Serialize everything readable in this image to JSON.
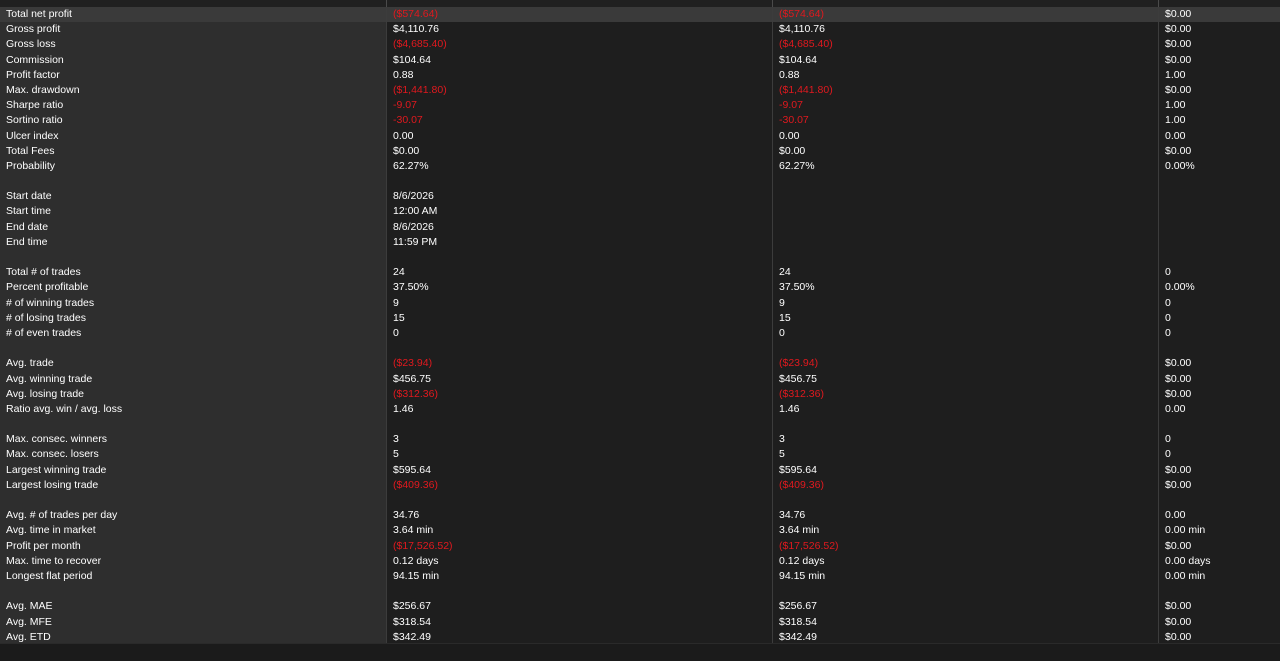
{
  "rows": [
    {
      "label": "Total net profit",
      "c1": "($574.64)",
      "c2": "($574.64)",
      "c3": "$0.00",
      "neg1": true,
      "neg2": true
    },
    {
      "label": "Gross profit",
      "c1": "$4,110.76",
      "c2": "$4,110.76",
      "c3": "$0.00"
    },
    {
      "label": "Gross loss",
      "c1": "($4,685.40)",
      "c2": "($4,685.40)",
      "c3": "$0.00",
      "neg1": true,
      "neg2": true
    },
    {
      "label": "Commission",
      "c1": "$104.64",
      "c2": "$104.64",
      "c3": "$0.00"
    },
    {
      "label": "Profit factor",
      "c1": "0.88",
      "c2": "0.88",
      "c3": "1.00"
    },
    {
      "label": "Max. drawdown",
      "c1": "($1,441.80)",
      "c2": "($1,441.80)",
      "c3": "$0.00",
      "neg1": true,
      "neg2": true
    },
    {
      "label": "Sharpe ratio",
      "c1": "-9.07",
      "c2": "-9.07",
      "c3": "1.00",
      "neg1": true,
      "neg2": true
    },
    {
      "label": "Sortino ratio",
      "c1": "-30.07",
      "c2": "-30.07",
      "c3": "1.00",
      "neg1": true,
      "neg2": true
    },
    {
      "label": "Ulcer index",
      "c1": "0.00",
      "c2": "0.00",
      "c3": "0.00"
    },
    {
      "label": "Total Fees",
      "c1": "$0.00",
      "c2": "$0.00",
      "c3": "$0.00"
    },
    {
      "label": "Probability",
      "c1": "62.27%",
      "c2": "62.27%",
      "c3": "0.00%"
    },
    {
      "gap": true
    },
    {
      "label": "Start date",
      "c1": "8/6/2026",
      "c2": "",
      "c3": ""
    },
    {
      "label": "Start time",
      "c1": "12:00 AM",
      "c2": "",
      "c3": ""
    },
    {
      "label": "End date",
      "c1": "8/6/2026",
      "c2": "",
      "c3": ""
    },
    {
      "label": "End time",
      "c1": "11:59 PM",
      "c2": "",
      "c3": ""
    },
    {
      "gap": true
    },
    {
      "label": "Total # of trades",
      "c1": "24",
      "c2": "24",
      "c3": "0"
    },
    {
      "label": "Percent profitable",
      "c1": "37.50%",
      "c2": "37.50%",
      "c3": "0.00%"
    },
    {
      "label": "# of winning trades",
      "c1": "9",
      "c2": "9",
      "c3": "0"
    },
    {
      "label": "# of losing trades",
      "c1": "15",
      "c2": "15",
      "c3": "0"
    },
    {
      "label": "# of even trades",
      "c1": "0",
      "c2": "0",
      "c3": "0"
    },
    {
      "gap": true
    },
    {
      "label": "Avg. trade",
      "c1": "($23.94)",
      "c2": "($23.94)",
      "c3": "$0.00",
      "neg1": true,
      "neg2": true
    },
    {
      "label": "Avg. winning trade",
      "c1": "$456.75",
      "c2": "$456.75",
      "c3": "$0.00"
    },
    {
      "label": "Avg. losing trade",
      "c1": "($312.36)",
      "c2": "($312.36)",
      "c3": "$0.00",
      "neg1": true,
      "neg2": true
    },
    {
      "label": "Ratio avg. win / avg. loss",
      "c1": "1.46",
      "c2": "1.46",
      "c3": "0.00"
    },
    {
      "gap": true
    },
    {
      "label": "Max. consec. winners",
      "c1": "3",
      "c2": "3",
      "c3": "0"
    },
    {
      "label": "Max. consec. losers",
      "c1": "5",
      "c2": "5",
      "c3": "0"
    },
    {
      "label": "Largest winning trade",
      "c1": "$595.64",
      "c2": "$595.64",
      "c3": "$0.00"
    },
    {
      "label": "Largest losing trade",
      "c1": "($409.36)",
      "c2": "($409.36)",
      "c3": "$0.00",
      "neg1": true,
      "neg2": true
    },
    {
      "gap": true
    },
    {
      "label": "Avg. # of trades per day",
      "c1": "34.76",
      "c2": "34.76",
      "c3": "0.00"
    },
    {
      "label": "Avg. time in market",
      "c1": "3.64 min",
      "c2": "3.64 min",
      "c3": "0.00 min"
    },
    {
      "label": "Profit per month",
      "c1": "($17,526.52)",
      "c2": "($17,526.52)",
      "c3": "$0.00",
      "neg1": true,
      "neg2": true
    },
    {
      "label": "Max. time to recover",
      "c1": "0.12 days",
      "c2": "0.12 days",
      "c3": "0.00 days"
    },
    {
      "label": "Longest flat period",
      "c1": "94.15 min",
      "c2": "94.15 min",
      "c3": "0.00 min"
    },
    {
      "gap": true
    },
    {
      "label": "Avg. MAE",
      "c1": "$256.67",
      "c2": "$256.67",
      "c3": "$0.00"
    },
    {
      "label": "Avg. MFE",
      "c1": "$318.54",
      "c2": "$318.54",
      "c3": "$0.00"
    },
    {
      "label": "Avg. ETD",
      "c1": "$342.49",
      "c2": "$342.49",
      "c3": "$0.00"
    }
  ],
  "colors": {
    "negative": "#e0191e",
    "text": "#ffffff",
    "label_bg": "#2e2e2e",
    "bg": "#1e1e1e"
  }
}
